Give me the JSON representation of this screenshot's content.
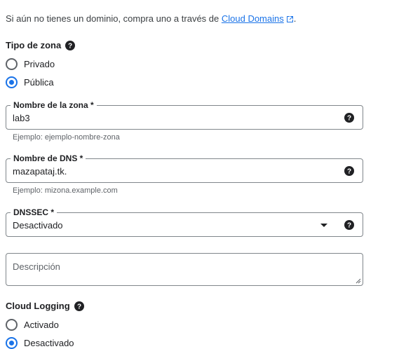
{
  "intro": {
    "text": "Si aún no tienes un dominio, compra uno a través de ",
    "link": "Cloud Domains",
    "suffix": "."
  },
  "zone_type": {
    "label": "Tipo de zona",
    "options": [
      {
        "label": "Privado",
        "checked": false
      },
      {
        "label": "Pública",
        "checked": true
      }
    ]
  },
  "zone_name": {
    "label": "Nombre de la zona *",
    "value": "lab3",
    "hint": "Ejemplo: ejemplo-nombre-zona"
  },
  "dns_name": {
    "label": "Nombre de DNS *",
    "value": "mazapataj.tk.",
    "hint": "Ejemplo: mizona.example.com"
  },
  "dnssec": {
    "label": "DNSSEC *",
    "value": "Desactivado"
  },
  "description": {
    "placeholder": "Descripción"
  },
  "cloud_logging": {
    "label": "Cloud Logging",
    "options": [
      {
        "label": "Activado",
        "checked": false
      },
      {
        "label": "Desactivado",
        "checked": true
      }
    ]
  },
  "colors": {
    "accent": "#1a73e8",
    "border": "#80868b",
    "hint": "#5f6368"
  }
}
